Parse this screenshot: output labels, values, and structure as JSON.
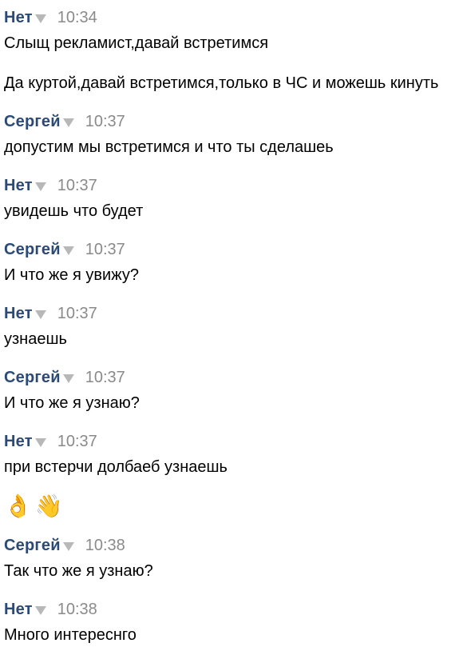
{
  "messages": [
    {
      "author": "Нет",
      "time": "10:34",
      "lines": [
        "Слыщ рекламист,давай встретимся",
        "Да куртой,давай встретимся,только в ЧС и можешь кинуть"
      ]
    },
    {
      "author": "Сергей",
      "time": "10:37",
      "lines": [
        "допустим мы встретимся и что ты сделашеь"
      ]
    },
    {
      "author": "Нет",
      "time": "10:37",
      "lines": [
        "увидешь что будет"
      ]
    },
    {
      "author": "Сергей",
      "time": "10:37",
      "lines": [
        "И что же я увижу?"
      ]
    },
    {
      "author": "Нет",
      "time": "10:37",
      "lines": [
        "узнаешь"
      ]
    },
    {
      "author": "Сергей",
      "time": "10:37",
      "lines": [
        "И что же я узнаю?"
      ]
    },
    {
      "author": "Нет",
      "time": "10:37",
      "lines": [
        "при встерчи долбаеб узнаешь"
      ]
    },
    {
      "author": "Сергей",
      "time": "10:38",
      "lines": [
        "Так что же я узнаю?"
      ]
    },
    {
      "author": "Нет",
      "time": "10:38",
      "lines": [
        "Много интереснго"
      ]
    }
  ],
  "emojis": [
    {
      "icon": "ok-hand-icon",
      "glyph": "👌"
    },
    {
      "icon": "waving-hand-icon",
      "glyph": "👋"
    }
  ]
}
